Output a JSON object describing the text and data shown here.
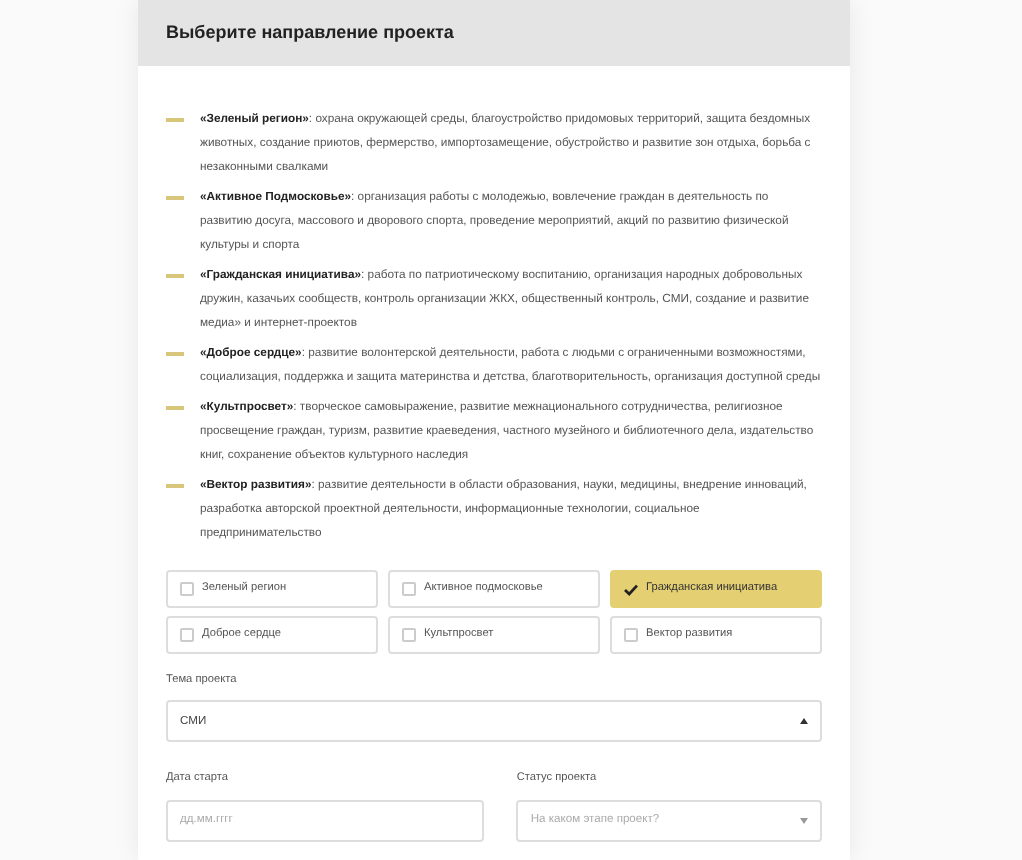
{
  "header": {
    "title": "Выберите направление проекта"
  },
  "directions": [
    {
      "text": "**«Зеленый регион»**: охрана окружающей среды, благоустройство придомовых территорий, защита бездомных животных, создание приютов, фермерство, импортозамещение, обустройство и развитие зон отдыха, борьба с незаконными свалками"
    },
    {
      "text": "**«Активное Подмосковье»**: организация работы с молодежью, вовлечение граждан в деятельность по развитию досуга, массового и дворового спорта, проведение мероприятий, акций по развитию физической культуры и спорта"
    },
    {
      "text": "**«Гражданская инициатива»**: работа по патриотическому воспитанию, организация народных добровольных дружин, казачьих сообществ, контроль организации ЖКХ, общественный контроль, СМИ, создание и развитие медиа» и интернет-проектов"
    },
    {
      "text": "**«Доброе сердце»**: развитие волонтерской деятельности, работа с людьми с ограниченными возможностями, социализация, поддержка и защита материнства и детства, благотворительность, организация доступной среды"
    },
    {
      "text": "**«Культпросвет»**: творческое самовыражение, развитие межнационального сотрудничества, религиозное просвещение граждан, туризм, развитие краеведения, частного музейного и библиотечного дела, издательство книг, сохранение объектов культурного наследия"
    },
    {
      "text": "**«Вектор развития»**: развитие деятельности в области образования, науки, медицины, внедрение инноваций, разработка авторской проектной деятельности, информационные технологии, социальное предпринимательство"
    }
  ],
  "options": [
    {
      "label": "Зеленый регион",
      "selected": false
    },
    {
      "label": "Активное подмосковье",
      "selected": false
    },
    {
      "label": "Гражданская инициатива",
      "selected": true
    },
    {
      "label": "Доброе сердце",
      "selected": false
    },
    {
      "label": "Культпросвет",
      "selected": false
    },
    {
      "label": "Вектор развития",
      "selected": false
    }
  ],
  "topic": {
    "label": "Тема проекта",
    "value": "СМИ"
  },
  "start_date": {
    "label": "Дата старта",
    "placeholder": "дд.мм.гггг"
  },
  "status": {
    "label": "Статус проекта",
    "placeholder": "На каком этапе проект?"
  }
}
